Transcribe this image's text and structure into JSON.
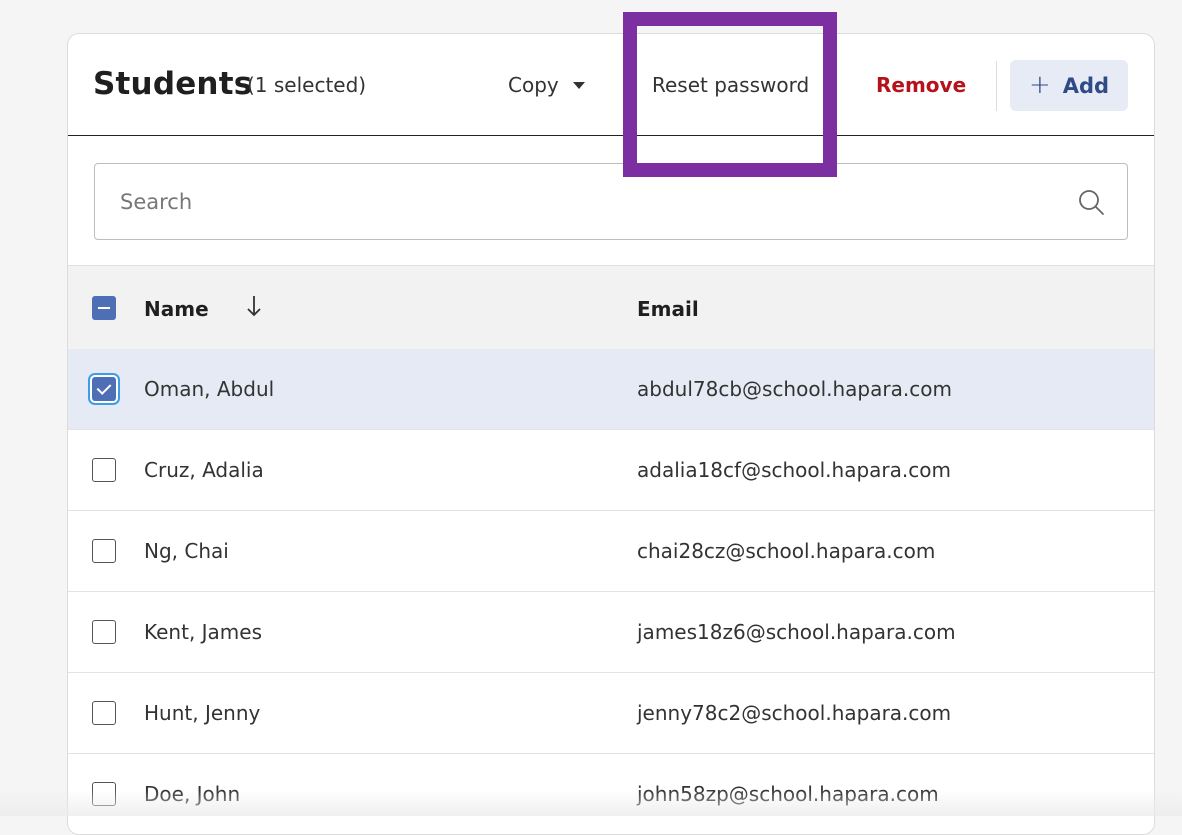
{
  "header": {
    "title": "Students",
    "selected_count": "(1 selected)",
    "copy_label": "Copy",
    "reset_label": "Reset password",
    "remove_label": "Remove",
    "add_label": "Add",
    "add_icon": "+"
  },
  "search": {
    "placeholder": "Search",
    "value": ""
  },
  "table": {
    "columns": [
      "Name",
      "Email"
    ],
    "sort": "descending-arrow",
    "rows": [
      {
        "name": "Oman, Abdul",
        "email": "abdul78cb@school.hapara.com",
        "checked": true
      },
      {
        "name": "Cruz, Adalia",
        "email": "adalia18cf@school.hapara.com",
        "checked": false
      },
      {
        "name": "Ng, Chai",
        "email": "chai28cz@school.hapara.com",
        "checked": false
      },
      {
        "name": "Kent, James",
        "email": "james18z6@school.hapara.com",
        "checked": false
      },
      {
        "name": "Hunt, Jenny",
        "email": "jenny78c2@school.hapara.com",
        "checked": false
      },
      {
        "name": "Doe, John",
        "email": "john58zp@school.hapara.com",
        "checked": false
      }
    ]
  },
  "colors": {
    "accent": "#4e6fb5",
    "remove": "#b5121b",
    "add_bg": "#e7ebf5",
    "selected_row": "#e6eaf4",
    "highlight": "#7b2fa0"
  }
}
